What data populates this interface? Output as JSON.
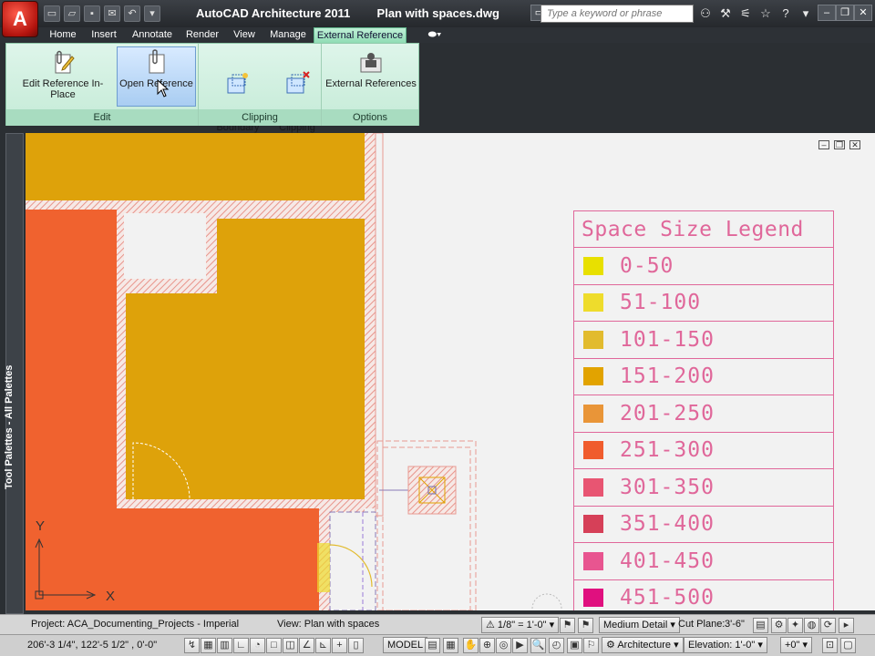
{
  "app": {
    "logo_letter": "A",
    "title": "AutoCAD Architecture 2011",
    "document": "Plan with spaces.dwg"
  },
  "search": {
    "placeholder": "Type a keyword or phrase"
  },
  "ribbon": {
    "tabs": [
      "Home",
      "Insert",
      "Annotate",
      "Render",
      "View",
      "Manage",
      "External Reference"
    ],
    "active_tab": "External Reference",
    "panels": {
      "edit": {
        "label": "Edit",
        "buttons": [
          "Edit Reference In-Place",
          "Open Reference"
        ]
      },
      "clipping": {
        "label": "Clipping",
        "buttons": [
          "Create Clipping\nBoundary",
          "Remove\nClipping"
        ]
      },
      "options": {
        "label": "Options",
        "buttons": [
          "External References"
        ]
      }
    }
  },
  "tool_palette": {
    "label": "Tool Palettes - All Palettes"
  },
  "drawing": {
    "ucs_x": "X",
    "ucs_y": "Y",
    "legend": {
      "title": "Space Size Legend",
      "rows": [
        {
          "range": "0-50",
          "color": "#e8e000"
        },
        {
          "range": "51-100",
          "color": "#eedc2c"
        },
        {
          "range": "101-150",
          "color": "#e2bb2e"
        },
        {
          "range": "151-200",
          "color": "#e2a300"
        },
        {
          "range": "201-250",
          "color": "#e99538"
        },
        {
          "range": "251-300",
          "color": "#f05c2d"
        },
        {
          "range": "301-350",
          "color": "#e85572"
        },
        {
          "range": "351-400",
          "color": "#d64058"
        },
        {
          "range": "401-450",
          "color": "#e85590"
        },
        {
          "range": "451-500",
          "color": "#e0107f"
        }
      ]
    },
    "colors": {
      "orange_space": "#f0622f",
      "gold_space": "#dea20a",
      "hatch": "#e89a93",
      "background": "#f2f2f2"
    }
  },
  "status": {
    "project": "Project: ACA_Documenting_Projects - Imperial",
    "view": "View: Plan with spaces",
    "scale": "1/8\" = 1'-0\"",
    "detail": "Medium Detail",
    "cut_plane_label": "Cut Plane:",
    "cut_plane_value": "3'-6\"",
    "coords": "206'-3 1/4\",  122'-5 1/2\" , 0'-0\"",
    "model": "MODEL",
    "workspace": "Architecture",
    "elevation": "Elevation: 1'-0\"",
    "offset": "+0\""
  }
}
